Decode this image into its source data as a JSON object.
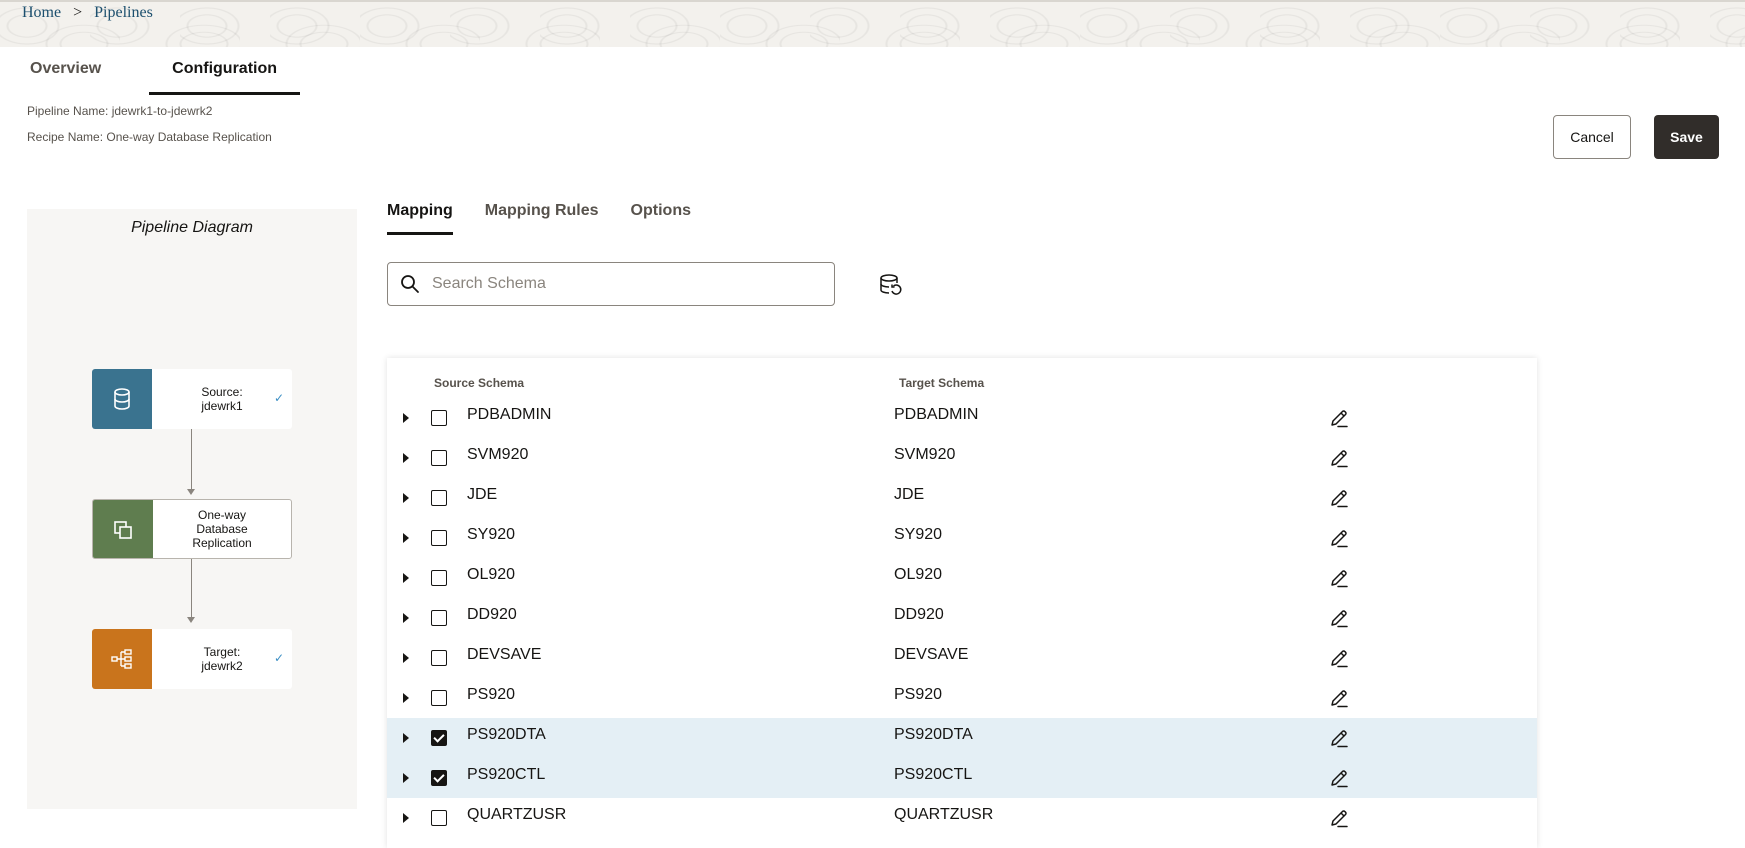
{
  "breadcrumb": {
    "home": "Home",
    "separator": ">",
    "current": "Pipelines"
  },
  "tabs": [
    {
      "label": "Overview",
      "active": false
    },
    {
      "label": "Configuration",
      "active": true
    }
  ],
  "meta": {
    "pipeline_name": "Pipeline Name: jdewrk1-to-jdewrk2",
    "recipe_name": "Recipe Name: One-way Database Replication"
  },
  "actions": {
    "cancel": "Cancel",
    "save": "Save"
  },
  "diagram": {
    "title": "Pipeline Diagram",
    "source": {
      "label": "Source:\njdewrk1",
      "icon": "database-icon",
      "color": "#3a738f",
      "status": "✓"
    },
    "recipe": {
      "label": "One-way\nDatabase\nReplication",
      "icon": "copy-icon",
      "color": "#5f7d4f"
    },
    "target": {
      "label": "Target:\njdewrk2",
      "icon": "hierarchy-icon",
      "color": "#c9741c",
      "status": "✓"
    }
  },
  "subtabs": [
    {
      "label": "Mapping",
      "active": true
    },
    {
      "label": "Mapping Rules",
      "active": false
    },
    {
      "label": "Options",
      "active": false
    }
  ],
  "search": {
    "placeholder": "Search Schema",
    "value": ""
  },
  "table": {
    "headers": {
      "source": "Source Schema",
      "target": "Target Schema"
    },
    "rows": [
      {
        "source": "PDBADMIN",
        "target": "PDBADMIN",
        "checked": false
      },
      {
        "source": "SVM920",
        "target": "SVM920",
        "checked": false
      },
      {
        "source": "JDE",
        "target": "JDE",
        "checked": false
      },
      {
        "source": "SY920",
        "target": "SY920",
        "checked": false
      },
      {
        "source": "OL920",
        "target": "OL920",
        "checked": false
      },
      {
        "source": "DD920",
        "target": "DD920",
        "checked": false
      },
      {
        "source": "DEVSAVE",
        "target": "DEVSAVE",
        "checked": false
      },
      {
        "source": "PS920",
        "target": "PS920",
        "checked": false
      },
      {
        "source": "PS920DTA",
        "target": "PS920DTA",
        "checked": true
      },
      {
        "source": "PS920CTL",
        "target": "PS920CTL",
        "checked": true
      },
      {
        "source": "QUARTZUSR",
        "target": "QUARTZUSR",
        "checked": false
      }
    ]
  }
}
